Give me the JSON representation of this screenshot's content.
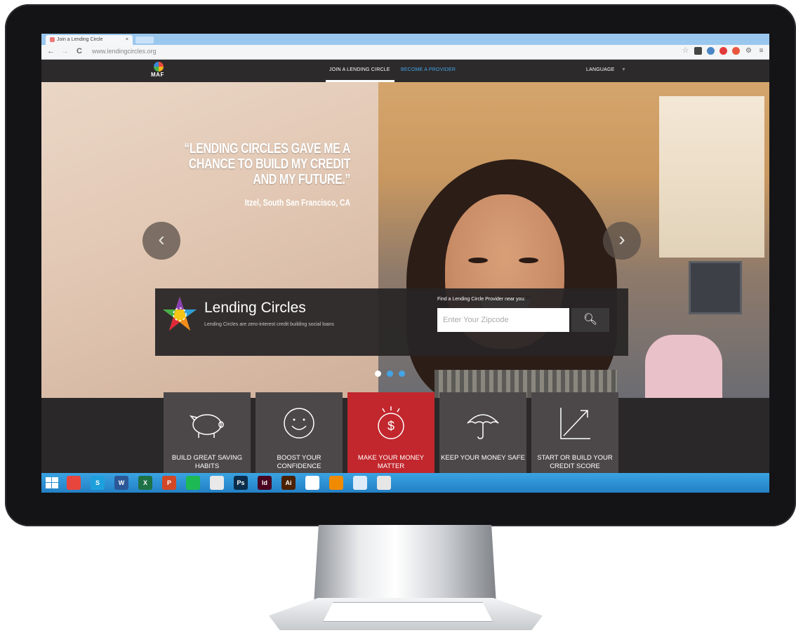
{
  "browser": {
    "tab_title": "Join a Lending Circle",
    "tab_close": "×",
    "url": "www.lendingcircles.org",
    "back": "←",
    "forward": "→",
    "reload": "C"
  },
  "site_nav": {
    "logo_text": "MAF",
    "links": [
      "JOIN A LENDING CIRCLE",
      "BECOME A PROVIDER"
    ],
    "language": "LANGUAGE"
  },
  "hero": {
    "quote": "“LENDING CIRCLES GAVE ME A CHANCE TO BUILD MY CREDIT AND MY FUTURE.”",
    "attribution": "Itzel, South San Francisco, CA",
    "prev_arrow": "‹",
    "next_arrow": "›"
  },
  "promo": {
    "title": "Lending Circles",
    "subtitle": "Lending Circles are zero-interest credit building social loans",
    "finder_label": "Find a Lending Circle Provider near you:",
    "zip_placeholder": "Enter Your Zipcode"
  },
  "carousel": {
    "active_index": 0,
    "count": 3
  },
  "features": [
    {
      "label": "BUILD GREAT SAVING HABITS",
      "icon": "piggy-bank-icon",
      "active": false
    },
    {
      "label": "BOOST YOUR CONFIDENCE",
      "icon": "smiley-icon",
      "active": false
    },
    {
      "label": "MAKE YOUR MONEY MATTER",
      "icon": "dollar-coin-icon",
      "active": true
    },
    {
      "label": "KEEP YOUR MONEY SAFE",
      "icon": "umbrella-icon",
      "active": false
    },
    {
      "label": "START OR BUILD YOUR CREDIT SCORE",
      "icon": "growth-arrow-icon",
      "active": false
    }
  ],
  "taskbar": {
    "apps": [
      {
        "name": "chrome-icon",
        "color": "#e8453c"
      },
      {
        "name": "skype-icon",
        "label": "S",
        "color": "#1ea0dc"
      },
      {
        "name": "word-icon",
        "label": "W",
        "color": "#2b5797"
      },
      {
        "name": "excel-icon",
        "label": "X",
        "color": "#1e7145"
      },
      {
        "name": "powerpoint-icon",
        "label": "P",
        "color": "#d24726"
      },
      {
        "name": "spotify-icon",
        "color": "#1db954"
      },
      {
        "name": "calendar-icon",
        "color": "#e9e9e9"
      },
      {
        "name": "photoshop-icon",
        "label": "Ps",
        "color": "#0b2d4b"
      },
      {
        "name": "indesign-icon",
        "label": "Id",
        "color": "#49021f"
      },
      {
        "name": "illustrator-icon",
        "label": "Ai",
        "color": "#4b2100"
      },
      {
        "name": "acrobat-icon",
        "color": "#ffffff"
      },
      {
        "name": "vlc-icon",
        "color": "#f08a00"
      },
      {
        "name": "snipping-icon",
        "color": "#dcebf7"
      },
      {
        "name": "onepassword-icon",
        "color": "#e6e6e6"
      }
    ]
  },
  "colors": {
    "accent_red": "#c1272d",
    "nav_bg": "#2c2a2b",
    "link_blue": "#45a3e5",
    "taskbar_blue": "#2a8ed6"
  }
}
